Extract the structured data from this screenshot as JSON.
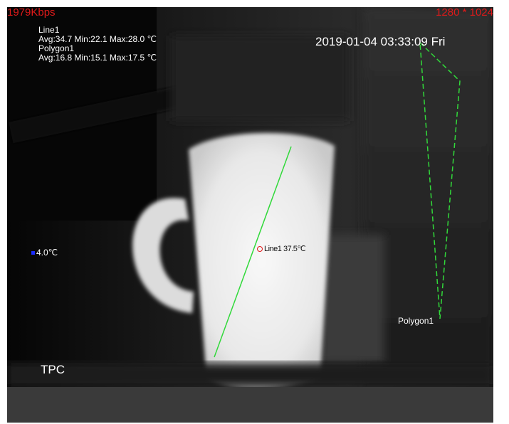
{
  "stream": {
    "bitrate": "1979Kbps",
    "resolution": "1280 * 1024"
  },
  "rules": [
    {
      "name": "Line1",
      "stats": "Avg:34.7 Min:22.1 Max:28.0 ℃"
    },
    {
      "name": "Polygon1",
      "stats": "Avg:16.8 Min:15.1 Max:17.5 ℃"
    }
  ],
  "osd": {
    "datetime": "2019-01-04 03:33:09 Fri",
    "channel_label": "TPC",
    "cold_spot": "4.0℃",
    "line_label": "Line1 37.5℃",
    "polygon_label": "Polygon1"
  },
  "colors": {
    "overlay_red": "#e01a1a",
    "rule_green": "#31d93a",
    "cold_marker": "#1a2cff"
  }
}
